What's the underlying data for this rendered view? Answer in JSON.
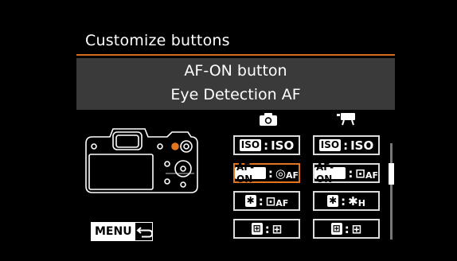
{
  "screen": {
    "title": "Customize buttons",
    "button_name": "AF-ON button",
    "function_name": "Eye Detection AF",
    "columns": [
      "still-photo-icon",
      "movie-icon"
    ],
    "rows": [
      {
        "still": {
          "source": "ISO",
          "function": "ISO",
          "fn_sub": ""
        },
        "movie": {
          "source": "ISO",
          "function": "ISO",
          "fn_sub": ""
        }
      },
      {
        "still": {
          "source": "AF-ON",
          "function": "◎",
          "fn_sub": "AF"
        },
        "movie": {
          "source": "AF-ON",
          "function": "⊡",
          "fn_sub": "AF"
        }
      },
      {
        "still": {
          "source": "✱",
          "function": "⊡",
          "fn_sub": "AF"
        },
        "movie": {
          "source": "✱",
          "function": "✱",
          "fn_sub": "H"
        }
      },
      {
        "still": {
          "source": "⊞",
          "function": "⊞",
          "fn_sub": ""
        },
        "movie": {
          "source": "⊞",
          "function": "⊞",
          "fn_sub": ""
        }
      }
    ],
    "selected_cell": "still-row-2",
    "menu_button_label": "MENU",
    "accent_color": "#e3751f",
    "scroll_position": 0.25
  }
}
